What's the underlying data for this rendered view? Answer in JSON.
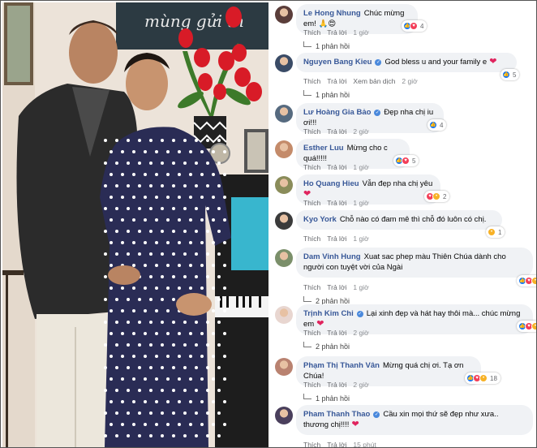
{
  "photo": {
    "wall_script": "mùng gửi th",
    "colors": {
      "wall": "#ece3d9",
      "dress": "#2a2c55",
      "dots": "#ffffff",
      "jacket": "#2b2b2b",
      "tulip": "#d81b27",
      "leaf": "#3d7a2a",
      "piano": "#1d1d1d",
      "cyan_panel": "#38b6ce"
    }
  },
  "comments": [
    {
      "name": "Le Hong Nhung",
      "verified": false,
      "text": "Chúc mừng em! 🙏😍",
      "like": "Thích",
      "reply": "Trả lời",
      "time": "1 giờ",
      "reactions": [
        "like",
        "love"
      ],
      "count": "4",
      "replies": "1 phản hồi",
      "avatar_color": "#5a3d3a"
    },
    {
      "name": "Nguyen Bang Kieu",
      "verified": true,
      "text": "God bless u and your family e",
      "heart": "❤",
      "like": "Thích",
      "reply": "Trả lời",
      "translate": "Xem bản dịch",
      "time": "2 giờ",
      "reactions": [
        "like"
      ],
      "count": "5",
      "replies": "1 phản hồi",
      "avatar_color": "#3a4b66"
    },
    {
      "name": "Lư Hoàng Gia Bảo",
      "verified": true,
      "text": "Đẹp nha chị iu ơi!!!",
      "like": "Thích",
      "reply": "Trả lời",
      "time": "2 giờ",
      "reactions": [
        "like"
      ],
      "count": "4",
      "avatar_color": "#566a7f"
    },
    {
      "name": "Esther Luu",
      "verified": false,
      "text": "Mừng cho c quá!!!!!",
      "like": "Thích",
      "reply": "Trả lời",
      "time": "1 giờ",
      "reactions": [
        "like",
        "love"
      ],
      "count": "5",
      "avatar_color": "#c48b6a"
    },
    {
      "name": "Ho Quang Hieu",
      "verified": false,
      "text": "Vẫn đẹp nha chị yêu",
      "heart": "❤",
      "like": "Thích",
      "reply": "Trả lời",
      "time": "1 giờ",
      "reactions": [
        "love",
        "care"
      ],
      "count": "2",
      "avatar_color": "#8a8c5a"
    },
    {
      "name": "Kyo York",
      "verified": false,
      "text": "Chỗ nào có đam mê thì chỗ đó luôn có chị.",
      "like": "Thích",
      "reply": "Trả lời",
      "time": "1 giờ",
      "reactions": [
        "care"
      ],
      "count": "1",
      "avatar_color": "#3b3b3b"
    },
    {
      "name": "Dam Vinh Hung",
      "verified": false,
      "text": "Xuat sac phep màu Thiên Chúa dành cho người con tuyệt vời của Ngài",
      "like": "Thích",
      "reply": "Trả lời",
      "time": "1 giờ",
      "reactions": [
        "like",
        "love",
        "care"
      ],
      "count": "",
      "replies": "2 phản hồi",
      "avatar_color": "#7b8f6a"
    },
    {
      "name": "Trịnh Kim Chi",
      "verified": true,
      "text": "Lại xinh đẹp và hát hay thôi mà... chúc mừng em",
      "heart": "❤",
      "like": "Thích",
      "reply": "Trả lời",
      "time": "2 giờ",
      "reactions": [
        "like",
        "love",
        "care"
      ],
      "count": "",
      "replies": "2 phản hồi",
      "avatar_color": "#e8d6d0"
    },
    {
      "name": "Phạm Thị Thanh Vân",
      "verified": false,
      "text": "Mừng quá chị ơi. Tạ ơn Chúa!",
      "like": "Thích",
      "reply": "Trả lời",
      "time": "2 giờ",
      "reactions": [
        "like",
        "love",
        "care"
      ],
      "count": "18",
      "replies": "1 phản hồi",
      "avatar_color": "#b98270"
    },
    {
      "name": "Pham Thanh Thao",
      "verified": true,
      "text": "Cầu xin mọi thứ sẽ đẹp như xưa.. thương chị!!!!",
      "heart": "❤",
      "like": "Thích",
      "reply": "Trả lời",
      "time": "15 phút",
      "reactions": [],
      "count": "",
      "avatar_color": "#4a3f5c"
    }
  ]
}
